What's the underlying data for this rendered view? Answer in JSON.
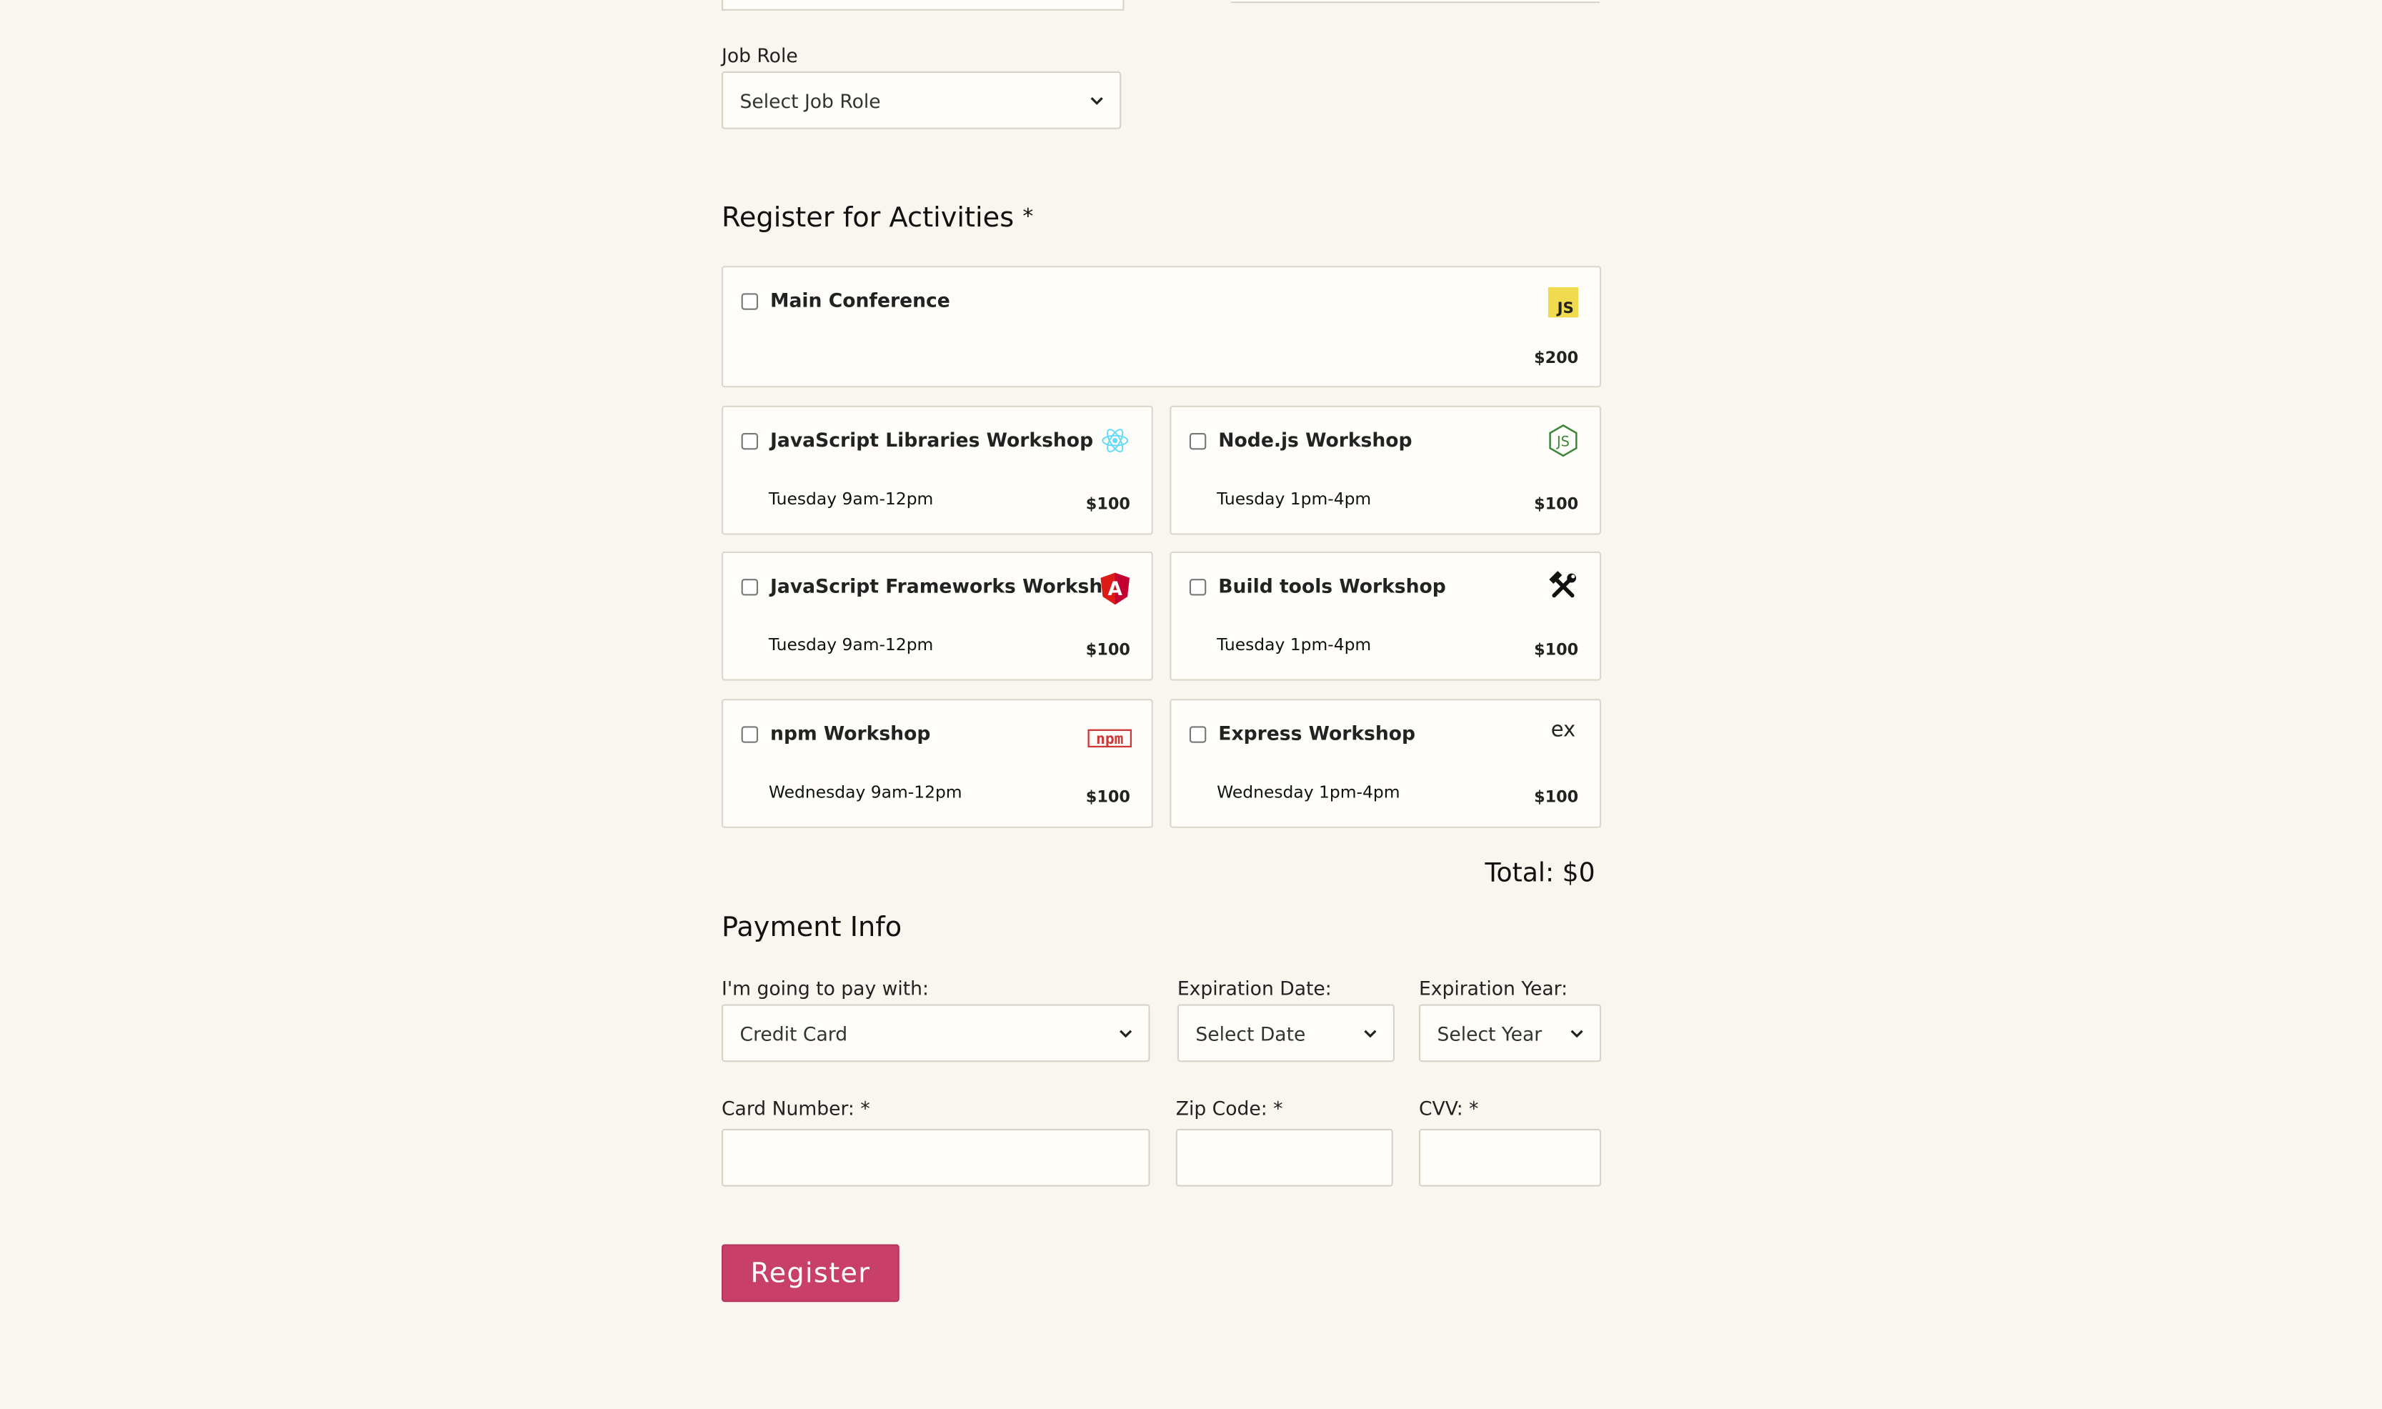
{
  "job_role": {
    "label": "Job Role",
    "selected": "Select Job Role"
  },
  "activities": {
    "heading": "Register for Activities",
    "required_mark": "*",
    "items": [
      {
        "title": "Main Conference",
        "time": "",
        "price": "$200",
        "icon": "javascript-logo-icon",
        "icon_text": "JS"
      },
      {
        "title": "JavaScript Libraries Workshop",
        "time": "Tuesday 9am-12pm",
        "price": "$100",
        "icon": "react-logo-icon"
      },
      {
        "title": "Node.js Workshop",
        "time": "Tuesday 1pm-4pm",
        "price": "$100",
        "icon": "nodejs-logo-icon",
        "icon_text": "JS"
      },
      {
        "title": "JavaScript Frameworks Workshop",
        "time": "Tuesday 9am-12pm",
        "price": "$100",
        "icon": "angular-logo-icon",
        "icon_text": "A"
      },
      {
        "title": "Build tools Workshop",
        "time": "Tuesday 1pm-4pm",
        "price": "$100",
        "icon": "hammer-wrench-icon"
      },
      {
        "title": "npm Workshop",
        "time": "Wednesday 9am-12pm",
        "price": "$100",
        "icon": "npm-logo-icon",
        "icon_text": "npm"
      },
      {
        "title": "Express Workshop",
        "time": "Wednesday 1pm-4pm",
        "price": "$100",
        "icon": "express-logo-icon",
        "icon_text": "ex"
      }
    ],
    "total": "Total: $0"
  },
  "payment": {
    "heading": "Payment Info",
    "method_label": "I'm going to pay with:",
    "method_selected": "Credit Card",
    "exp_date_label": "Expiration Date:",
    "exp_date_selected": "Select Date",
    "exp_year_label": "Expiration Year:",
    "exp_year_selected": "Select Year",
    "card_number_label": "Card Number:",
    "zip_label": "Zip Code:",
    "cvv_label": "CVV:",
    "required_mark": "*",
    "card_number_value": "",
    "zip_value": "",
    "cvv_value": ""
  },
  "register_button": "Register",
  "colors": {
    "background": "#f9f5ef",
    "button": "#c8406a",
    "js_yellow": "#f0db4f",
    "react_blue": "#61dafb",
    "node_green": "#3c873a",
    "angular_red": "#dd1b16",
    "npm_red": "#cb3837"
  }
}
